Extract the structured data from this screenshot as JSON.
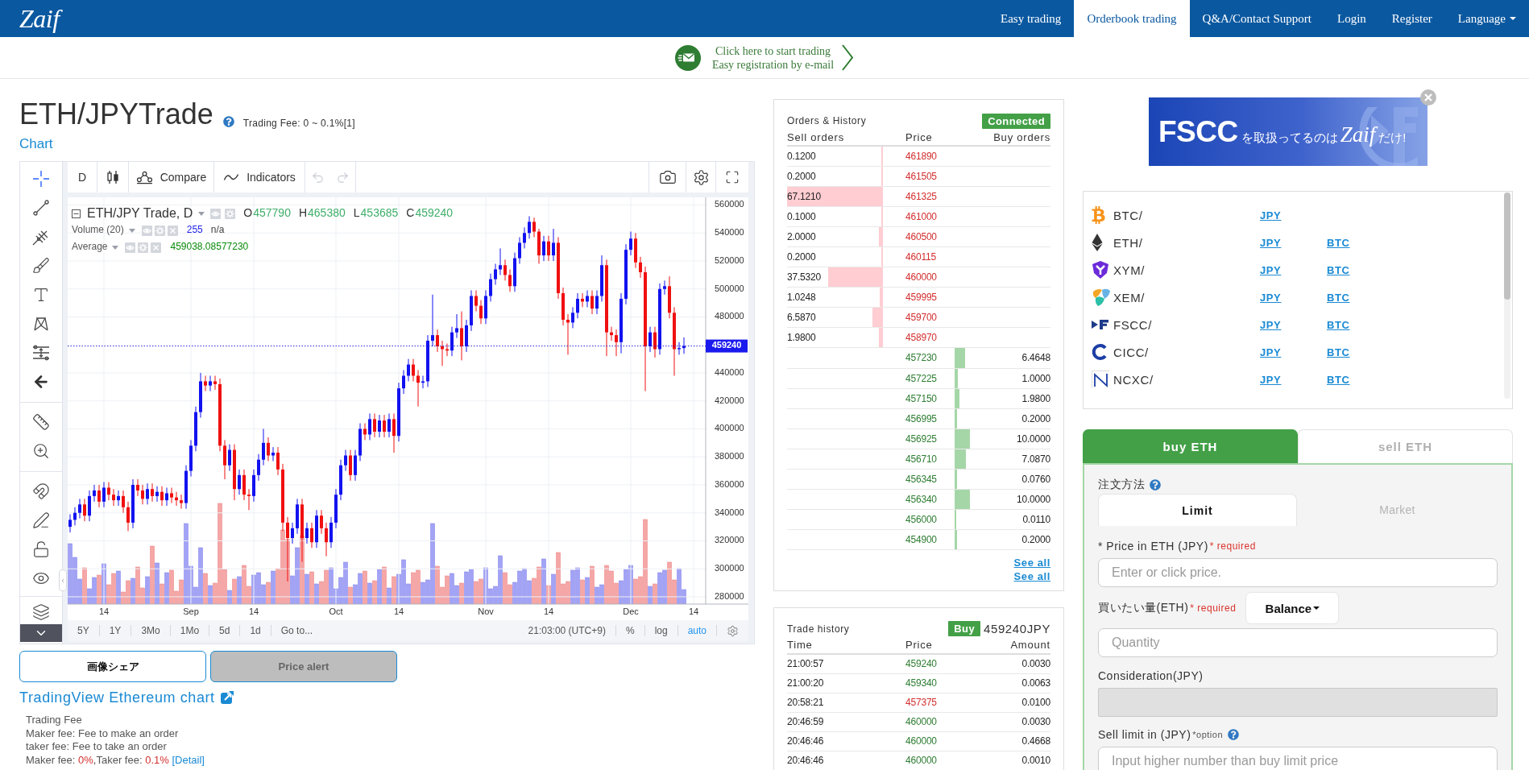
{
  "nav": {
    "logo": "Zaif",
    "items": [
      {
        "label": "Easy trading",
        "selected": false,
        "dropdown": false
      },
      {
        "label": "Orderbook trading",
        "selected": true,
        "dropdown": false
      },
      {
        "label": "Q&A/Contact Support",
        "selected": false,
        "dropdown": false
      },
      {
        "label": "Login",
        "selected": false,
        "dropdown": false
      },
      {
        "label": "Register",
        "selected": false,
        "dropdown": false
      },
      {
        "label": "Language",
        "selected": false,
        "dropdown": true
      }
    ]
  },
  "promo": {
    "lines": [
      "Click here to start trading",
      "Easy registration by e-mail"
    ]
  },
  "header": {
    "title": "ETH/JPYTrade",
    "fee": "Trading Fee: 0 ~ 0.1%[1]",
    "chart_link": "Chart"
  },
  "chart_widget": {
    "interval": "D",
    "toolbar": [
      {
        "kind": "compare",
        "label": "Compare"
      },
      {
        "kind": "indicators",
        "label": "Indicators"
      }
    ],
    "undo_disabled": true,
    "redo_disabled": true,
    "legend": {
      "symbol": "ETH/JPY Trade, D",
      "ohlc": [
        {
          "key": "O",
          "value": "457790"
        },
        {
          "key": "H",
          "value": "465380"
        },
        {
          "key": "L",
          "value": "453685"
        },
        {
          "key": "C",
          "value": "459240"
        }
      ],
      "studies": [
        {
          "name": "Volume (20)",
          "values": [
            {
              "text": "255",
              "color": "#2323e8"
            },
            {
              "text": "n/a",
              "color": "#444444"
            }
          ]
        },
        {
          "name": "Average",
          "values": [
            {
              "text": "459038.08577230",
              "color": "#0a8a0a"
            }
          ]
        }
      ]
    },
    "chart_data": {
      "type": "candlestick",
      "grid": true,
      "ylim": [
        274800,
        565500
      ],
      "yticks": [
        280000,
        300000,
        320000,
        340000,
        360000,
        380000,
        400000,
        420000,
        440000,
        480000,
        500000,
        520000,
        540000,
        560000
      ],
      "categories": [
        null,
        null,
        null,
        null,
        null,
        null,
        null,
        "14",
        null,
        null,
        null,
        null,
        null,
        null,
        null,
        null,
        null,
        null,
        null,
        null,
        null,
        null,
        null,
        null,
        null,
        "Sep",
        null,
        null,
        null,
        null,
        null,
        null,
        null,
        null,
        null,
        null,
        null,
        null,
        "14",
        null,
        null,
        null,
        null,
        null,
        null,
        null,
        null,
        null,
        null,
        null,
        null,
        null,
        null,
        null,
        null,
        "Oct",
        null,
        null,
        null,
        null,
        null,
        null,
        null,
        null,
        null,
        null,
        null,
        null,
        "14",
        null,
        null,
        null,
        null,
        null,
        null,
        null,
        null,
        null,
        null,
        null,
        null,
        null,
        null,
        null,
        null,
        null,
        "Nov",
        null,
        null,
        null,
        null,
        null,
        null,
        null,
        null,
        null,
        null,
        null,
        null,
        "14",
        null,
        null,
        null,
        null,
        null,
        null,
        null,
        null,
        null,
        null,
        null,
        null,
        null,
        null,
        null,
        null,
        "Dec",
        null,
        null,
        null,
        null,
        null,
        null,
        null,
        null,
        null,
        null,
        null,
        null,
        "14",
        null,
        null
      ],
      "ohlc": [
        [
          330000,
          339000,
          326000,
          335000
        ],
        [
          335000,
          344000,
          331000,
          340000
        ],
        [
          340000,
          350000,
          336000,
          346000
        ],
        [
          346000,
          350000,
          334000,
          338000
        ],
        [
          338000,
          356000,
          334000,
          352000
        ],
        [
          352000,
          360000,
          348000,
          356000
        ],
        [
          356000,
          360000,
          344000,
          348000
        ],
        [
          348000,
          362000,
          344000,
          358000
        ],
        [
          358000,
          362000,
          349000,
          353000
        ],
        [
          353000,
          357000,
          345000,
          349000
        ],
        [
          349000,
          356000,
          345000,
          352000
        ],
        [
          352000,
          356000,
          340000,
          344000
        ],
        [
          344000,
          348000,
          327000,
          333000
        ],
        [
          333000,
          364000,
          329000,
          360000
        ],
        [
          360000,
          364000,
          352000,
          356000
        ],
        [
          356000,
          360000,
          346000,
          350000
        ],
        [
          350000,
          361000,
          346000,
          357000
        ],
        [
          357000,
          361000,
          348000,
          352000
        ],
        [
          352000,
          359000,
          348000,
          355000
        ],
        [
          355000,
          359000,
          345000,
          349000
        ],
        [
          349000,
          358000,
          345000,
          354000
        ],
        [
          354000,
          358000,
          347000,
          351000
        ],
        [
          351000,
          355000,
          345000,
          349000
        ],
        [
          349000,
          353000,
          343000,
          347000
        ],
        [
          347000,
          374000,
          343000,
          370000
        ],
        [
          370000,
          392000,
          366000,
          388000
        ],
        [
          388000,
          416000,
          384000,
          412000
        ],
        [
          412000,
          440000,
          408000,
          434000
        ],
        [
          434000,
          438000,
          427000,
          431000
        ],
        [
          431000,
          438000,
          427000,
          434000
        ],
        [
          434000,
          438000,
          428000,
          432000
        ],
        [
          432000,
          436000,
          384000,
          388000
        ],
        [
          388000,
          392000,
          364000,
          374000
        ],
        [
          374000,
          389000,
          370000,
          385000
        ],
        [
          385000,
          389000,
          349000,
          357000
        ],
        [
          357000,
          371000,
          353000,
          367000
        ],
        [
          367000,
          371000,
          349000,
          353000
        ],
        [
          353000,
          357000,
          342000,
          352000
        ],
        [
          352000,
          371000,
          348000,
          367000
        ],
        [
          367000,
          382000,
          363000,
          378000
        ],
        [
          378000,
          400000,
          374000,
          390000
        ],
        [
          390000,
          394000,
          377000,
          381000
        ],
        [
          381000,
          387000,
          377000,
          383000
        ],
        [
          383000,
          387000,
          367000,
          371000
        ],
        [
          371000,
          375000,
          327000,
          333000
        ],
        [
          333000,
          337000,
          291000,
          322000
        ],
        [
          322000,
          333000,
          318000,
          329000
        ],
        [
          329000,
          350000,
          325000,
          346000
        ],
        [
          346000,
          350000,
          305000,
          322000
        ],
        [
          322000,
          333000,
          318000,
          329000
        ],
        [
          329000,
          333000,
          315000,
          319000
        ],
        [
          319000,
          342000,
          315000,
          338000
        ],
        [
          338000,
          342000,
          325000,
          329000
        ],
        [
          329000,
          333000,
          309000,
          319000
        ],
        [
          319000,
          337000,
          315000,
          333000
        ],
        [
          333000,
          357000,
          329000,
          353000
        ],
        [
          353000,
          378000,
          349000,
          374000
        ],
        [
          374000,
          385000,
          370000,
          381000
        ],
        [
          381000,
          385000,
          363000,
          367000
        ],
        [
          367000,
          385000,
          363000,
          381000
        ],
        [
          381000,
          404000,
          377000,
          400000
        ],
        [
          400000,
          404000,
          392000,
          396000
        ],
        [
          396000,
          411000,
          392000,
          407000
        ],
        [
          407000,
          411000,
          394000,
          398000
        ],
        [
          398000,
          410000,
          394000,
          406000
        ],
        [
          406000,
          410000,
          394000,
          398000
        ],
        [
          398000,
          411000,
          394000,
          407000
        ],
        [
          407000,
          411000,
          383000,
          395000
        ],
        [
          395000,
          433000,
          391000,
          429000
        ],
        [
          429000,
          442000,
          425000,
          438000
        ],
        [
          438000,
          450000,
          434000,
          446000
        ],
        [
          446000,
          450000,
          434000,
          438000
        ],
        [
          438000,
          442000,
          416000,
          433000
        ],
        [
          433000,
          438000,
          429000,
          434000
        ],
        [
          434000,
          467000,
          430000,
          463000
        ],
        [
          463000,
          496000,
          459000,
          467000
        ],
        [
          467000,
          471000,
          455000,
          459000
        ],
        [
          459000,
          463000,
          445000,
          457000
        ],
        [
          457000,
          461000,
          452000,
          456000
        ],
        [
          456000,
          473000,
          452000,
          469000
        ],
        [
          469000,
          482000,
          465000,
          472000
        ],
        [
          472000,
          484000,
          449000,
          459000
        ],
        [
          459000,
          478000,
          455000,
          474000
        ],
        [
          474000,
          499000,
          470000,
          495000
        ],
        [
          495000,
          499000,
          484000,
          488000
        ],
        [
          488000,
          492000,
          475000,
          479000
        ],
        [
          479000,
          499000,
          475000,
          495000
        ],
        [
          495000,
          511000,
          491000,
          507000
        ],
        [
          507000,
          518000,
          503000,
          514000
        ],
        [
          514000,
          529000,
          510000,
          517000
        ],
        [
          517000,
          521000,
          506000,
          510000
        ],
        [
          510000,
          514000,
          498000,
          502000
        ],
        [
          502000,
          526000,
          498000,
          522000
        ],
        [
          522000,
          537000,
          518000,
          533000
        ],
        [
          533000,
          544000,
          529000,
          540000
        ],
        [
          540000,
          552000,
          536000,
          548000
        ],
        [
          548000,
          551000,
          537000,
          541000
        ],
        [
          541000,
          543000,
          518000,
          524000
        ],
        [
          524000,
          538000,
          520000,
          534000
        ],
        [
          534000,
          538000,
          520000,
          524000
        ],
        [
          524000,
          543000,
          520000,
          533000
        ],
        [
          533000,
          537000,
          493000,
          497000
        ],
        [
          497000,
          501000,
          474000,
          478000
        ],
        [
          478000,
          482000,
          453000,
          476000
        ],
        [
          476000,
          487000,
          472000,
          483000
        ],
        [
          483000,
          497000,
          479000,
          493000
        ],
        [
          493000,
          497000,
          487000,
          491000
        ],
        [
          491000,
          499000,
          487000,
          495000
        ],
        [
          495000,
          499000,
          482000,
          486000
        ],
        [
          486000,
          499000,
          482000,
          495000
        ],
        [
          495000,
          524000,
          491000,
          517000
        ],
        [
          517000,
          521000,
          452000,
          469000
        ],
        [
          469000,
          473000,
          463000,
          467000
        ],
        [
          467000,
          471000,
          452000,
          462000
        ],
        [
          462000,
          497000,
          454000,
          493000
        ],
        [
          493000,
          532000,
          489000,
          528000
        ],
        [
          528000,
          541000,
          524000,
          536000
        ],
        [
          536000,
          540000,
          515000,
          519000
        ],
        [
          519000,
          523000,
          508000,
          512000
        ],
        [
          512000,
          516000,
          427000,
          459000
        ],
        [
          459000,
          473000,
          455000,
          469000
        ],
        [
          469000,
          473000,
          451000,
          457000
        ],
        [
          457000,
          504000,
          453000,
          500000
        ],
        [
          500000,
          506000,
          496000,
          502000
        ],
        [
          502000,
          509000,
          479000,
          483000
        ],
        [
          483000,
          487000,
          438000,
          457000
        ],
        [
          457000,
          462000,
          453000,
          457790
        ],
        [
          457790,
          465380,
          453685,
          459240
        ],
        null,
        null,
        null,
        null
      ],
      "ref_lines": [
        {
          "axis": "y",
          "value": 459240,
          "label": "459240"
        }
      ]
    },
    "ranges": [
      "5Y",
      "1Y",
      "3Mo",
      "1Mo",
      "5d",
      "1d",
      "Go to..."
    ],
    "time": "21:03:00 (UTC+9)",
    "scale_toggles": [
      {
        "label": "%",
        "selected": false
      },
      {
        "label": "log",
        "selected": false
      },
      {
        "label": "auto",
        "selected": true
      }
    ]
  },
  "actions": [
    {
      "label": "画像シェア",
      "disabled": false
    },
    {
      "label": "Price alert",
      "disabled": true
    }
  ],
  "tradingview_link": "TradingView Ethereum chart",
  "fees": {
    "title": "Trading Fee",
    "lines": [
      "Maker fee: Fee to make an order",
      "taker fee: Fee to take an order"
    ],
    "summary": {
      "maker_label": "Maker fee:",
      "maker_value": "0%",
      "taker_label": ",Taker fee:",
      "taker_value": "0.1%",
      "detail_link": "[Detail]"
    }
  },
  "orderbook": {
    "title": "Orders & History",
    "status": "Connected",
    "connected": true,
    "columns": [
      "Sell orders",
      "Price",
      "Buy orders"
    ],
    "rows": [
      {
        "kind": "sell",
        "amount": "0.1200",
        "price": "461890",
        "level": 0.0018
      },
      {
        "kind": "sell",
        "amount": "0.2000",
        "price": "461505",
        "level": 0.003
      },
      {
        "kind": "sell",
        "amount": "67.1210",
        "price": "461325",
        "level": 1
      },
      {
        "kind": "sell",
        "amount": "0.1000",
        "price": "461000",
        "level": 0.0015
      },
      {
        "kind": "sell",
        "amount": "2.0000",
        "price": "460500",
        "level": 0.03
      },
      {
        "kind": "sell",
        "amount": "0.2000",
        "price": "460115",
        "level": 0.003
      },
      {
        "kind": "sell",
        "amount": "37.5320",
        "price": "460000",
        "level": 0.56
      },
      {
        "kind": "sell",
        "amount": "1.0248",
        "price": "459995",
        "level": 0.015
      },
      {
        "kind": "sell",
        "amount": "6.5870",
        "price": "459700",
        "level": 0.098
      },
      {
        "kind": "sell",
        "amount": "1.9800",
        "price": "458970",
        "level": 0.03
      },
      {
        "kind": "buy",
        "amount": "6.4648",
        "price": "457230",
        "level": 0.096
      },
      {
        "kind": "buy",
        "amount": "1.0000",
        "price": "457225",
        "level": 0.015
      },
      {
        "kind": "buy",
        "amount": "1.9800",
        "price": "457150",
        "level": 0.03
      },
      {
        "kind": "buy",
        "amount": "0.2000",
        "price": "456995",
        "level": 0.003
      },
      {
        "kind": "buy",
        "amount": "10.0000",
        "price": "456925",
        "level": 0.149
      },
      {
        "kind": "buy",
        "amount": "7.0870",
        "price": "456710",
        "level": 0.106
      },
      {
        "kind": "buy",
        "amount": "0.0760",
        "price": "456345",
        "level": 0.0011
      },
      {
        "kind": "buy",
        "amount": "10.0000",
        "price": "456340",
        "level": 0.149
      },
      {
        "kind": "buy",
        "amount": "0.0110",
        "price": "456000",
        "level": 0.0002
      },
      {
        "kind": "buy",
        "amount": "0.2000",
        "price": "454900",
        "level": 0.003
      }
    ],
    "links": [
      "See all",
      "See all"
    ]
  },
  "trade_history": {
    "title": "Trade history",
    "last_trade": {
      "kind": "buy",
      "label": "Buy",
      "price": "459240JPY"
    },
    "columns": [
      "Time",
      "Price",
      "Amount"
    ],
    "rows": [
      {
        "kind": "buy",
        "time": "21:00:57",
        "price": "459240",
        "amount": "0.0030"
      },
      {
        "kind": "buy",
        "time": "21:00:20",
        "price": "459340",
        "amount": "0.0063"
      },
      {
        "kind": "sell",
        "time": "20:58:21",
        "price": "457375",
        "amount": "0.0100"
      },
      {
        "kind": "buy",
        "time": "20:46:59",
        "price": "460000",
        "amount": "0.0030"
      },
      {
        "kind": "buy",
        "time": "20:46:46",
        "price": "460000",
        "amount": "0.4668"
      },
      {
        "kind": "buy",
        "time": "20:46:46",
        "price": "460000",
        "amount": "0.0010"
      }
    ]
  },
  "ad": {
    "headline": "FSCC",
    "text": "を取扱ってるのは",
    "brand": "Zaif",
    "suffix": "だけ!"
  },
  "markets": [
    {
      "kind": "btc",
      "label": "BTC/",
      "links": [
        "JPY"
      ]
    },
    {
      "kind": "eth",
      "label": "ETH/",
      "links": [
        "JPY",
        "BTC"
      ]
    },
    {
      "kind": "xym",
      "label": "XYM/",
      "links": [
        "JPY",
        "BTC"
      ]
    },
    {
      "kind": "xem",
      "label": "XEM/",
      "links": [
        "JPY",
        "BTC"
      ]
    },
    {
      "kind": "fscc",
      "label": "FSCC/",
      "links": [
        "JPY",
        "BTC"
      ]
    },
    {
      "kind": "cicc",
      "label": "CICC/",
      "links": [
        "JPY",
        "BTC"
      ]
    },
    {
      "kind": "ncxc",
      "label": "NCXC/",
      "links": [
        "JPY",
        "BTC"
      ]
    }
  ],
  "trade_tabs": [
    {
      "label": "buy ETH",
      "selected": true
    },
    {
      "label": "sell ETH",
      "selected": false
    }
  ],
  "order_form": {
    "method_label": "注文方法",
    "order_types": [
      {
        "label": "Limit",
        "selected": true
      },
      {
        "label": "Market",
        "selected": false
      }
    ],
    "fields": [
      {
        "label": "* Price in ETH (JPY)",
        "note": "* required",
        "required": true,
        "help": false,
        "disabled": false,
        "placeholder": "Enter or click price."
      },
      {
        "label": "買いたい量(ETH)",
        "note": "* required",
        "required": true,
        "help": false,
        "disabled": false,
        "button": "Balance",
        "placeholder": "Quantity"
      },
      {
        "label": "Consideration(JPY)",
        "help": false,
        "disabled": true
      },
      {
        "label": "Sell limit in (JPY)",
        "note": "*option",
        "required": false,
        "help": true,
        "disabled": false,
        "placeholder": "Input higher number than buy limit price"
      }
    ]
  }
}
